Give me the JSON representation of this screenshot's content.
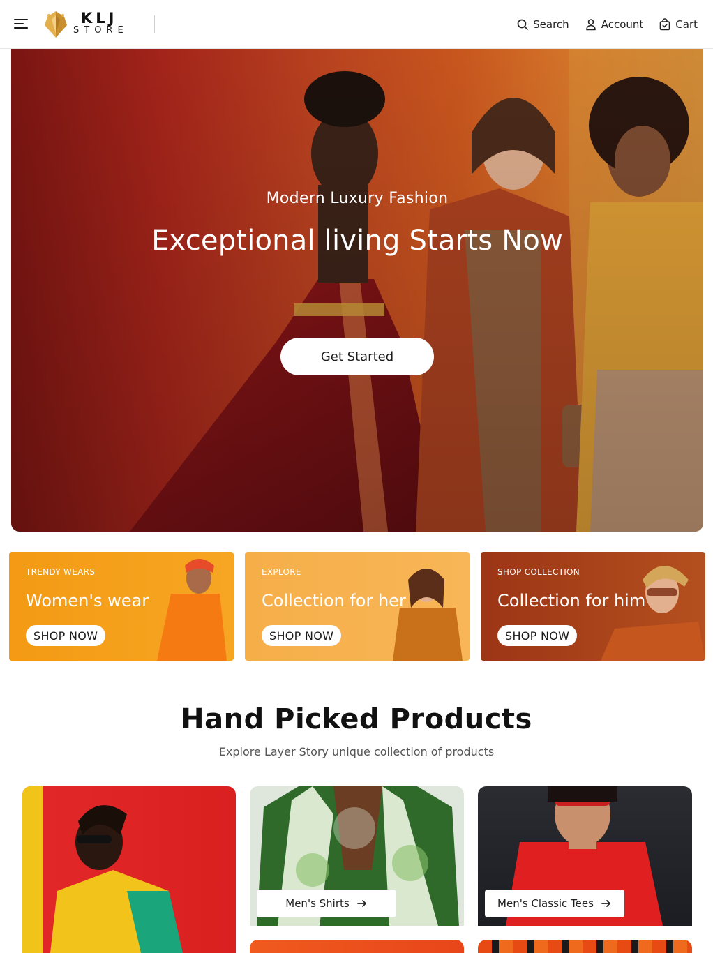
{
  "header": {
    "brand_line1": "KLJ",
    "brand_line2": "STORE",
    "nav": [
      {
        "label": "Search",
        "icon": "search-icon"
      },
      {
        "label": "Account",
        "icon": "user-icon"
      },
      {
        "label": "Cart",
        "icon": "shopping-bag-icon"
      }
    ]
  },
  "hero": {
    "subtitle": "Modern Luxury Fashion",
    "title": "Exceptional living Starts Now",
    "cta": "Get Started"
  },
  "promos": [
    {
      "eyebrow": "TRENDY WEARS",
      "title": "Women's wear",
      "cta": "SHOP NOW"
    },
    {
      "eyebrow": "EXPLORE",
      "title": "Collection for her",
      "cta": "SHOP NOW"
    },
    {
      "eyebrow": "SHOP COLLECTION",
      "title": "Collection for him",
      "cta": "SHOP NOW"
    }
  ],
  "section": {
    "title": "Hand Picked Products",
    "subtitle": "Explore Layer Story unique collection of products"
  },
  "products": [
    {
      "label": "Men's Shirts"
    },
    {
      "label": "Men's Classic Tees"
    }
  ],
  "colors": {
    "hero_red": "#a3241a",
    "hero_orange": "#d4762a",
    "promo_orange": "#f59a1d",
    "promo_light": "#f7b04a",
    "promo_rust": "#a8401a"
  }
}
